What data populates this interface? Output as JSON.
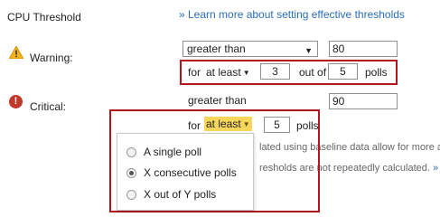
{
  "header": {
    "title": "CPU Threshold",
    "learn_more_link": "» Learn more about setting effective thresholds"
  },
  "warning": {
    "label": "Warning:",
    "operator": "greater than",
    "value": "80",
    "for_label": "for",
    "mode_label": "at least",
    "count": "3",
    "out_of_label": "out of",
    "total": "5",
    "polls_label": "polls"
  },
  "critical": {
    "label": "Critical:",
    "operator": "greater than",
    "value": "90",
    "for_label": "for",
    "mode_label": "at least",
    "count": "5",
    "polls_label": "polls"
  },
  "dropdown": {
    "options": [
      {
        "label": "A single poll",
        "selected": false
      },
      {
        "label": "X consecutive polls",
        "selected": true
      },
      {
        "label": "X out of Y polls",
        "selected": false
      }
    ]
  },
  "background_text": {
    "line1": "lated using baseline data allow for more acc",
    "line2": "resholds are not repeatedly calculated.",
    "line2_link": "» M"
  },
  "colors": {
    "link": "#2a6ebb",
    "highlight_box": "#b3151d",
    "selected_mode": "#f8d65c",
    "warning_icon": "#f2b21b",
    "critical_icon": "#c0392b"
  }
}
